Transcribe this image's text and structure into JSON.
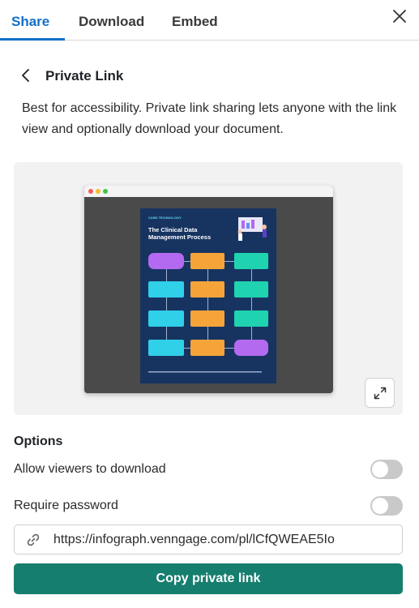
{
  "tabs": [
    {
      "label": "Share",
      "active": true
    },
    {
      "label": "Download",
      "active": false
    },
    {
      "label": "Embed",
      "active": false
    }
  ],
  "header": {
    "title": "Private Link",
    "description": "Best for accessibility. Private link sharing lets anyone with the link view and optionally download your document."
  },
  "preview": {
    "brand": "CARE TECHNOLOGY",
    "title": "The Clinical Data Management Process"
  },
  "options": {
    "title": "Options",
    "items": [
      {
        "label": "Allow viewers to download",
        "enabled": false
      },
      {
        "label": "Require password",
        "enabled": false
      }
    ]
  },
  "link": {
    "value": "https://infograph.venngage.com/pl/lCfQWEAE5Io"
  },
  "copy_button": {
    "label": "Copy private link"
  },
  "colors": {
    "accent": "#1470c8",
    "primary_button": "#167e6e",
    "toggle_off": "#c9c9c9"
  },
  "icons": [
    "close-icon",
    "chevron-left-icon",
    "expand-icon",
    "link-icon"
  ]
}
